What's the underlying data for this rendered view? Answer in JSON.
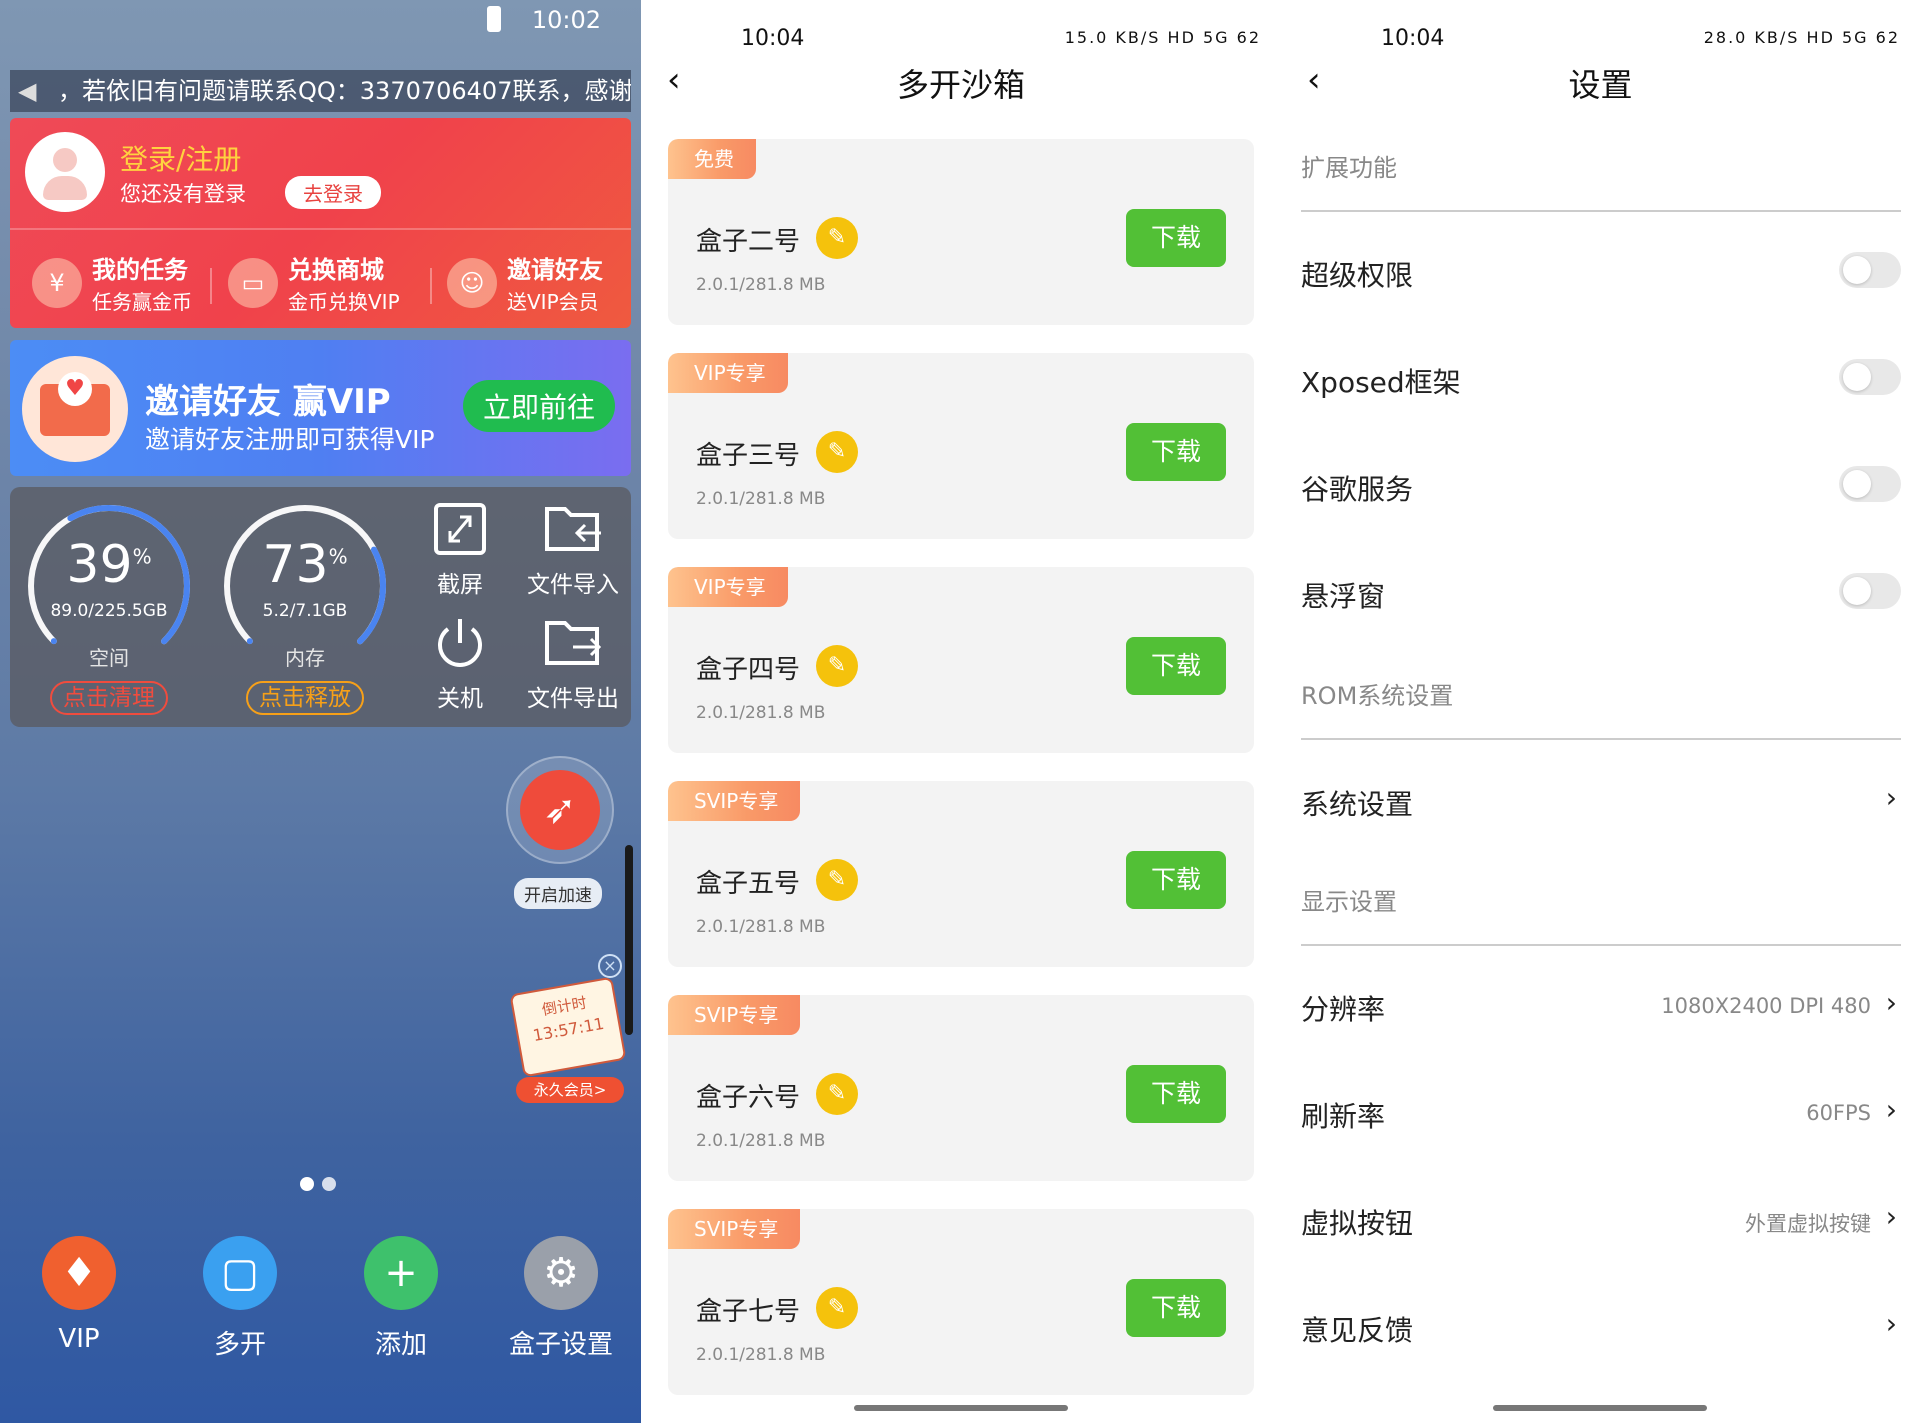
{
  "panel1": {
    "status_time": "10:02",
    "marquee": "，若依旧有问题请联系QQ：3370706407联系，感谢",
    "login": {
      "title": "登录/注册",
      "subtitle": "您还没有登录",
      "button": "去登录"
    },
    "quick_actions": [
      {
        "title": "我的任务",
        "sub": "任务赢金币",
        "icon": "coin-icon"
      },
      {
        "title": "兑换商城",
        "sub": "金币兑换VIP",
        "icon": "shop-icon"
      },
      {
        "title": "邀请好友",
        "sub": "送VIP会员",
        "icon": "add-user-icon"
      }
    ],
    "invite": {
      "title": "邀请好友 赢VIP",
      "subtitle": "邀请好友注册即可获得VIP",
      "button": "立即前往"
    },
    "storage": {
      "percent": "39",
      "detail": "89.0/225.5GB",
      "label": "空间",
      "button": "点击清理",
      "fraction": 0.39
    },
    "memory": {
      "percent": "73",
      "detail": "5.2/7.1GB",
      "label": "内存",
      "button": "点击释放",
      "fraction": 0.73
    },
    "percent_sign": "%",
    "tools": [
      {
        "label": "截屏",
        "icon": "screenshot-icon"
      },
      {
        "label": "文件导入",
        "icon": "file-import-icon"
      },
      {
        "label": "关机",
        "icon": "power-icon"
      },
      {
        "label": "文件导出",
        "icon": "file-export-icon"
      }
    ],
    "speed_label": "开启加速",
    "countdown": {
      "line1": "倒计时",
      "time": "13:57:11",
      "button": "永久会员>"
    },
    "dock": [
      {
        "label": "VIP",
        "icon": "vip-icon",
        "color": "#f0602f"
      },
      {
        "label": "多开",
        "icon": "multi-open-icon",
        "color": "#3aa0f0"
      },
      {
        "label": "添加",
        "icon": "add-icon",
        "color": "#3ec16c"
      },
      {
        "label": "盒子设置",
        "icon": "gear-icon",
        "color": "#9aa0aa"
      }
    ]
  },
  "panel2": {
    "status_time": "10:04",
    "status_right": "15.0 KB/S HD 5G 62",
    "title": "多开沙箱",
    "boxes": [
      {
        "tag": "免费",
        "name": "盒子二号",
        "size": "2.0.1/281.8 MB",
        "button": "下载"
      },
      {
        "tag": "VIP专享",
        "name": "盒子三号",
        "size": "2.0.1/281.8 MB",
        "button": "下载"
      },
      {
        "tag": "VIP专享",
        "name": "盒子四号",
        "size": "2.0.1/281.8 MB",
        "button": "下载"
      },
      {
        "tag": "SVIP专享",
        "name": "盒子五号",
        "size": "2.0.1/281.8 MB",
        "button": "下载"
      },
      {
        "tag": "SVIP专享",
        "name": "盒子六号",
        "size": "2.0.1/281.8 MB",
        "button": "下载"
      },
      {
        "tag": "SVIP专享",
        "name": "盒子七号",
        "size": "2.0.1/281.8 MB",
        "button": "下载"
      }
    ]
  },
  "panel3": {
    "status_time": "10:04",
    "status_right": "28.0 KB/S HD 5G 62",
    "title": "设置",
    "section_extend": "扩展功能",
    "toggles": [
      {
        "label": "超级权限",
        "on": false
      },
      {
        "label": "Xposed框架",
        "on": false
      },
      {
        "label": "谷歌服务",
        "on": false
      },
      {
        "label": "悬浮窗",
        "on": false
      }
    ],
    "section_rom": "ROM系统设置",
    "system_settings": "系统设置",
    "section_display": "显示设置",
    "resolution": {
      "label": "分辨率",
      "value": "1080X2400 DPI 480"
    },
    "refresh": {
      "label": "刷新率",
      "value": "60FPS"
    },
    "virtual_keys": {
      "label": "虚拟按钮",
      "value": "外置虚拟按键"
    },
    "feedback": "意见反馈"
  }
}
